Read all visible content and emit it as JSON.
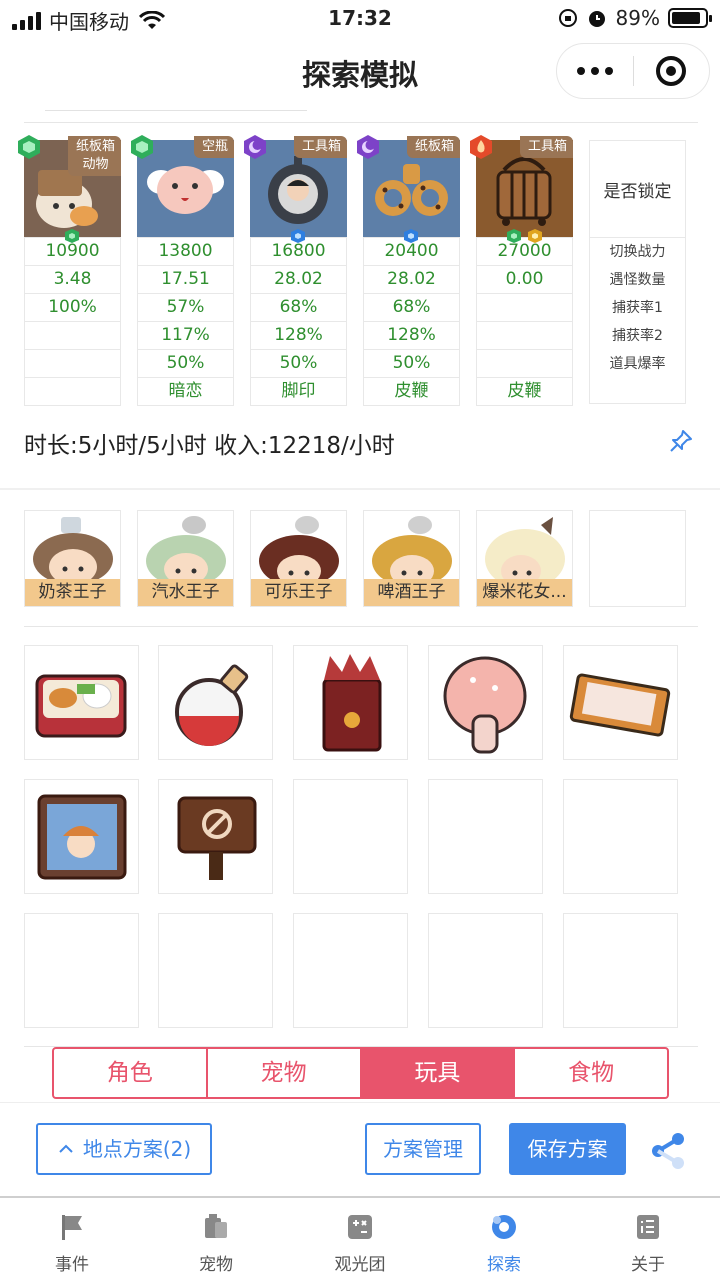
{
  "status": {
    "carrier": "中国移动",
    "time": "17:32",
    "battery": "89%",
    "battery_level": 0.89
  },
  "nav": {
    "title": "探索模拟"
  },
  "pets": [
    {
      "tag_line1": "纸板箱",
      "tag_line2": "动物",
      "gem": "green",
      "values": [
        "10900",
        "3.48",
        "100%",
        "",
        "",
        ""
      ]
    },
    {
      "tag_line1": "空瓶",
      "tag_line2": "",
      "gem": "green",
      "values": [
        "13800",
        "17.51",
        "57%",
        "117%",
        "50%",
        "暗恋"
      ]
    },
    {
      "tag_line1": "工具箱",
      "tag_line2": "",
      "gem": "purple",
      "values": [
        "16800",
        "28.02",
        "68%",
        "128%",
        "50%",
        "脚印"
      ]
    },
    {
      "tag_line1": "纸板箱",
      "tag_line2": "",
      "gem": "purple",
      "values": [
        "20400",
        "28.02",
        "68%",
        "128%",
        "50%",
        "皮鞭"
      ]
    },
    {
      "tag_line1": "工具箱",
      "tag_line2": "",
      "gem": "red",
      "values": [
        "27000",
        "0.00",
        "",
        "",
        "",
        "皮鞭"
      ]
    }
  ],
  "legend": {
    "lock": "是否锁定",
    "rows": [
      "切换战力",
      "遇怪数量",
      "捕获率1",
      "捕获率2",
      "道具爆率"
    ]
  },
  "summary": "时长:5小时/5小时 收入:12218/小时",
  "characters": [
    "奶茶王子",
    "汽水王子",
    "可乐王子",
    "啤酒王子",
    "爆米花女..."
  ],
  "tabs": [
    "角色",
    "宠物",
    "玩具",
    "食物"
  ],
  "active_tab": "玩具",
  "buttons": {
    "location_plan": "地点方案(2)",
    "plan_manage": "方案管理",
    "save_plan": "保存方案"
  },
  "tabbar": [
    "事件",
    "宠物",
    "观光团",
    "探索",
    "关于"
  ],
  "colors": {
    "accent_red": "#e8546c",
    "accent_blue": "#3f87e8",
    "value_green": "#2f8f2f",
    "label_tan": "#f2c88c"
  }
}
